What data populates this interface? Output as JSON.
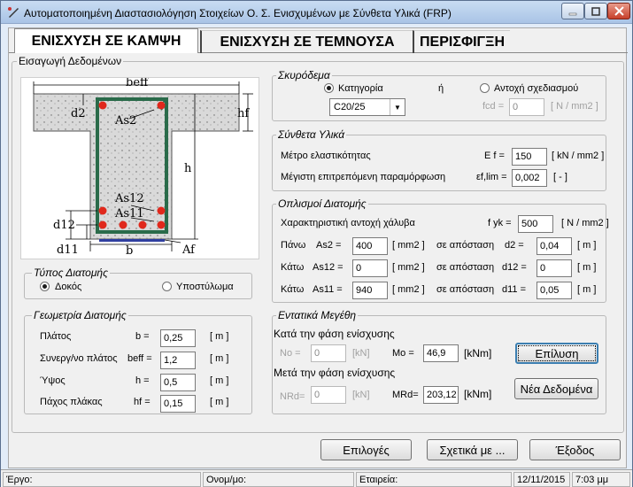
{
  "window": {
    "title": "Αυτοματοποιημένη Διαστασιολόγηση Στοιχείων Ο. Σ. Ενισχυμένων με Σύνθετα Υλικά  (FRP)"
  },
  "tabs": [
    {
      "label": "ΕΝΙΣΧΥΣΗ ΣΕ ΚΑΜΨΗ",
      "active": true
    },
    {
      "label": "ΕΝΙΣΧΥΣΗ ΣΕ ΤΕΜΝΟΥΣΑ",
      "active": false
    },
    {
      "label": "ΠΕΡΙΣΦΙΓΞΗ",
      "active": false
    }
  ],
  "input_group": {
    "legend": "Εισαγωγή Δεδομένων"
  },
  "diagram": {
    "beff": "beff",
    "hf": "hf",
    "d2": "d2",
    "As2": "As2",
    "h": "h",
    "As12": "As12",
    "As11": "As11",
    "d12": "d12",
    "d11": "d11",
    "b": "b",
    "Af": "Af"
  },
  "section_type": {
    "legend": "Τύπος Διατομής",
    "options": [
      {
        "label": "Δοκός",
        "selected": true
      },
      {
        "label": "Υποστύλωμα",
        "selected": false
      }
    ]
  },
  "geometry": {
    "legend": "Γεωμετρία Διατομής",
    "rows": [
      {
        "label": "Πλάτος",
        "sym": "b =",
        "value": "0,25",
        "unit": "[ m ]"
      },
      {
        "label": "Συνεργ/νο πλάτος",
        "sym": "beff =",
        "value": "1,2",
        "unit": "[ m ]"
      },
      {
        "label": "Ύψος",
        "sym": "h =",
        "value": "0,5",
        "unit": "[ m ]"
      },
      {
        "label": "Πάχος πλάκας",
        "sym": "hf =",
        "value": "0,15",
        "unit": "[ m ]"
      }
    ]
  },
  "concrete": {
    "legend": "Σκυρόδεμα",
    "opt_category": "Κατηγορία",
    "or_text": "ή",
    "opt_strength": "Αντοχή σχεδιασμού",
    "class_value": "C20/25",
    "fcd_label": "fcd =",
    "fcd_value": "0",
    "fcd_unit": "[ N / mm2 ]"
  },
  "composite": {
    "legend": "Σύνθετα Υλικά",
    "rows": [
      {
        "label": "Μέτρο ελαστικότητας",
        "sym": "E f =",
        "value": "150",
        "unit": "[ kN / mm2 ]"
      },
      {
        "label": "Μέγιστη επιτρεπόμενη παραμόρφωση",
        "sym": "εf,lim =",
        "value": "0,002",
        "unit": "[ - ]"
      }
    ]
  },
  "reinforcement": {
    "legend": "Οπλισμοί Διατομής",
    "fyk_label": "Χαρακτηριστική  αντοχή χάλυβα",
    "fyk_sym": "f yk =",
    "fyk_value": "500",
    "fyk_unit": "[ N / mm2 ]",
    "rows": [
      {
        "pos": "Πάνω",
        "sym": "As2 =",
        "value": "400",
        "unit": "[ mm2 ]",
        "dist_text": "σε απόσταση",
        "dsym": "d2 =",
        "dvalue": "0,04",
        "dunit": "[ m ]"
      },
      {
        "pos": "Κάτω",
        "sym": "As12 =",
        "value": "0",
        "unit": "[ mm2 ]",
        "dist_text": "σε απόσταση",
        "dsym": "d12 =",
        "dvalue": "0",
        "dunit": "[ m ]"
      },
      {
        "pos": "Κάτω",
        "sym": "As11 =",
        "value": "940",
        "unit": "[ mm2 ]",
        "dist_text": "σε απόσταση",
        "dsym": "d11 =",
        "dvalue": "0,05",
        "dunit": "[ m ]"
      }
    ]
  },
  "forces": {
    "legend": "Εντατικά Μεγέθη",
    "phase_during": "Κατά την φάση ενίσχυσης",
    "no_sym": "No =",
    "no_value": "0",
    "no_unit": "[kN]",
    "mo_sym": "Mo =",
    "mo_value": "46,9",
    "mo_unit": "[kNm]",
    "solve_button": "Επίλυση",
    "phase_after": "Μετά την φάση ενίσχυσης",
    "nrd_sym": "NRd=",
    "nrd_value": "0",
    "nrd_unit": "[kN]",
    "mrd_sym": "MRd=",
    "mrd_value": "203,12",
    "mrd_unit": "[kNm]",
    "new_data_button": "Νέα Δεδομένα"
  },
  "bottom_buttons": {
    "options": "Επιλογές",
    "about": "Σχετικά με ...",
    "exit": "Έξοδος"
  },
  "status": {
    "project": "Έργο:",
    "name": "Ονομ/μο:",
    "company": "Εταιρεία:",
    "date": "12/11/2015",
    "time": "7:03 μμ"
  },
  "colors": {
    "stirrup": "#2a6b4a",
    "rebar": "#e0281c",
    "concrete": "#d8d8d8",
    "frp": "#2f3fa0"
  }
}
